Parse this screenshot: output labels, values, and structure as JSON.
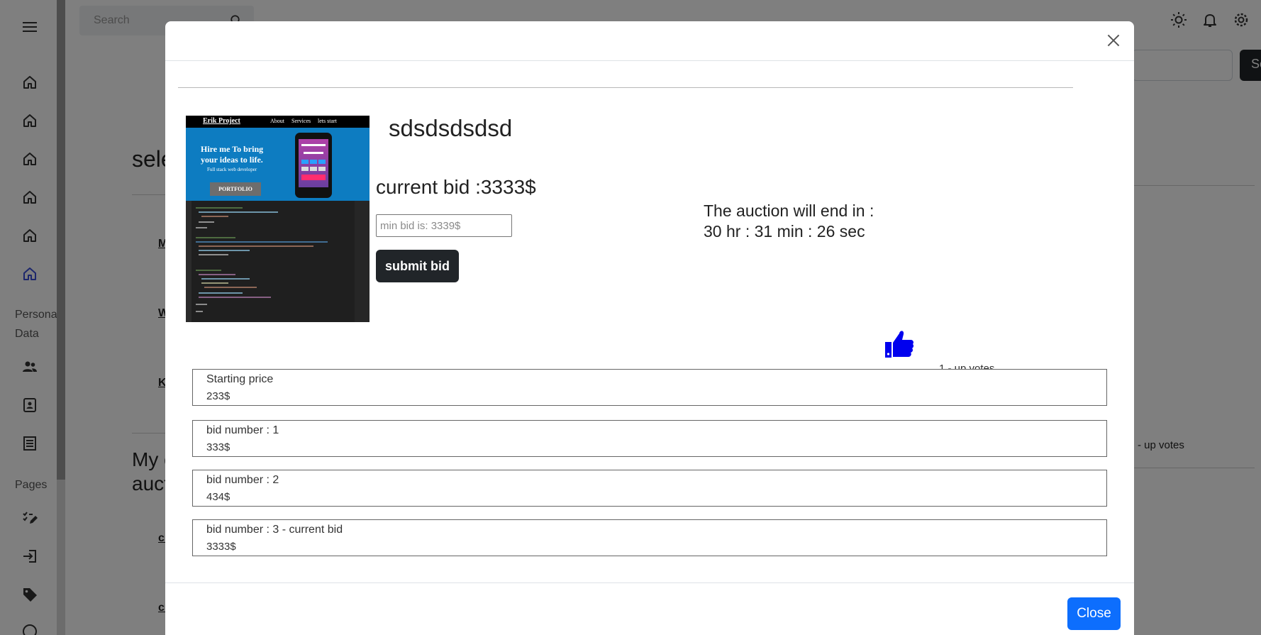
{
  "app": {
    "search_placeholder": "Search",
    "sidebar": {
      "personal_data_label": "Personal Data",
      "pages_label": "Pages"
    },
    "background": {
      "heading_1": "sele",
      "link_1": "M",
      "link_2": "W",
      "link_3": "K",
      "heading_2a": "My c",
      "heading_2b": "auct",
      "link_4": "cr",
      "link_5": "cr",
      "right_votes": "- up votes",
      "right_button_label": "Se"
    }
  },
  "modal": {
    "item_title": "sdsdsdsdsd",
    "current_bid_text": "current bid :3333$",
    "min_bid_placeholder": "min bid is: 3339$",
    "submit_label": "submit bid",
    "auction_end_label": "The auction will end in :",
    "auction_countdown": "30 hr : 31 min : 26 sec",
    "upvotes_text": "1 - up votes",
    "thumbnail": {
      "brand": "Erik Project",
      "nav": [
        "About",
        "Services",
        "lets start"
      ],
      "headline_1": "Hire me To bring",
      "headline_2": "your ideas to life.",
      "subline": "Full stack web developer",
      "button": "PORTFOLIO"
    },
    "bids": [
      {
        "label": "Starting price",
        "amount": "233$"
      },
      {
        "label": "bid number : 1",
        "amount": "333$"
      },
      {
        "label": "bid number : 2",
        "amount": "434$"
      },
      {
        "label": "bid number : 3 - current bid",
        "amount": "3333$"
      }
    ],
    "close_label": "Close",
    "colors": {
      "primary": "#0d6efd",
      "dark_button": "#212529",
      "thumbs_up": "#0000ee"
    }
  }
}
